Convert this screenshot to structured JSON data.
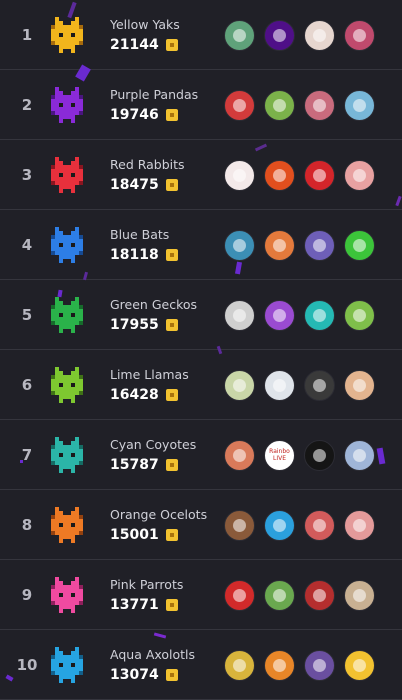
{
  "leaderboard": {
    "teams": [
      {
        "rank": "1",
        "name": "Yellow Yaks",
        "score": "21144",
        "color": "#f2b51c",
        "dark": "#a66a0c",
        "avatars": [
          {
            "name": "cat-avatar",
            "color": "#5fa27a"
          },
          {
            "name": "purple-avatar",
            "color": "#4f0f88"
          },
          {
            "name": "redhead-avatar",
            "color": "#e6d6cf"
          },
          {
            "name": "anime-girl-avatar",
            "color": "#c04a6d"
          }
        ]
      },
      {
        "rank": "2",
        "name": "Purple Pandas",
        "score": "19746",
        "color": "#8a2ad8",
        "dark": "#4a1580",
        "avatars": [
          {
            "name": "spider-avatar",
            "color": "#d33b3b"
          },
          {
            "name": "green-hat-avatar",
            "color": "#7bb24a"
          },
          {
            "name": "bandana-avatar",
            "color": "#c96b7d"
          },
          {
            "name": "blond-avatar",
            "color": "#78b7d8"
          }
        ]
      },
      {
        "rank": "3",
        "name": "Red Rabbits",
        "score": "18475",
        "color": "#e8303c",
        "dark": "#8a1520",
        "avatars": [
          {
            "name": "sheep-avatar",
            "color": "#f3e9e9"
          },
          {
            "name": "logo-s-avatar",
            "color": "#e24f1e"
          },
          {
            "name": "drop-avatar",
            "color": "#d4252a"
          },
          {
            "name": "pink-hair-avatar",
            "color": "#e8a1a1"
          }
        ]
      },
      {
        "rank": "4",
        "name": "Blue Bats",
        "score": "18118",
        "color": "#2d7ee6",
        "dark": "#164a92",
        "avatars": [
          {
            "name": "man-avatar",
            "color": "#3c8fb5"
          },
          {
            "name": "orange-hair-avatar",
            "color": "#e47a3c"
          },
          {
            "name": "goggles-avatar",
            "color": "#6e5fb8"
          },
          {
            "name": "green-cube-avatar",
            "color": "#3cc43a"
          }
        ]
      },
      {
        "rank": "5",
        "name": "Green Geckos",
        "score": "17955",
        "color": "#2ab24a",
        "dark": "#166b2b",
        "avatars": [
          {
            "name": "brunette-avatar",
            "color": "#cfcfcf"
          },
          {
            "name": "purple-hair-avatar",
            "color": "#9a4bd1"
          },
          {
            "name": "teal-avatar",
            "color": "#25b9b4"
          },
          {
            "name": "leaf-avatar",
            "color": "#7fbf4a"
          }
        ]
      },
      {
        "rank": "6",
        "name": "Lime Llamas",
        "score": "16428",
        "color": "#7ec830",
        "dark": "#3f7216",
        "avatars": [
          {
            "name": "green-eyed-avatar",
            "color": "#c9d6a8"
          },
          {
            "name": "white-hair-avatar",
            "color": "#dfe4ea"
          },
          {
            "name": "dark-avatar",
            "color": "#3a3a3a"
          },
          {
            "name": "bearded-avatar",
            "color": "#e3b48f"
          }
        ]
      },
      {
        "rank": "7",
        "name": "Cyan Coyotes",
        "score": "15787",
        "color": "#2bb5a8",
        "dark": "#156b63",
        "avatars": [
          {
            "name": "glasses-avatar",
            "color": "#d97a5a"
          },
          {
            "name": "rainbow-live-avatar",
            "color": "#ffffff"
          },
          {
            "name": "dark-figure-avatar",
            "color": "#151515"
          },
          {
            "name": "blond-man-avatar",
            "color": "#9fb5d8"
          }
        ]
      },
      {
        "rank": "8",
        "name": "Orange Ocelots",
        "score": "15001",
        "color": "#ee7a24",
        "dark": "#93410f",
        "avatars": [
          {
            "name": "room-avatar",
            "color": "#8a5a3a"
          },
          {
            "name": "penguin-avatar",
            "color": "#2ba0dd"
          },
          {
            "name": "red-girl-avatar",
            "color": "#d25b5b"
          },
          {
            "name": "smile-avatar",
            "color": "#e49a9a"
          }
        ]
      },
      {
        "rank": "9",
        "name": "Pink Parrots",
        "score": "13771",
        "color": "#f04aa0",
        "dark": "#8f1f5c",
        "avatars": [
          {
            "name": "ninja-avatar",
            "color": "#d22a2a"
          },
          {
            "name": "pixel-man-avatar",
            "color": "#6aa84f"
          },
          {
            "name": "hood-avatar",
            "color": "#b52e2e"
          },
          {
            "name": "blonde-avatar",
            "color": "#c8b092"
          }
        ]
      },
      {
        "rank": "10",
        "name": "Aqua Axolotls",
        "score": "13074",
        "color": "#26a4e2",
        "dark": "#125f8a",
        "avatars": [
          {
            "name": "yellow-monster-avatar",
            "color": "#d8b43c"
          },
          {
            "name": "orange-swirl-avatar",
            "color": "#e88628"
          },
          {
            "name": "purple-creature-avatar",
            "color": "#6a4fa0"
          },
          {
            "name": "bee-avatar",
            "color": "#f2c230"
          }
        ]
      }
    ],
    "avatar_label_7_2": "Rainbo LIVE"
  }
}
